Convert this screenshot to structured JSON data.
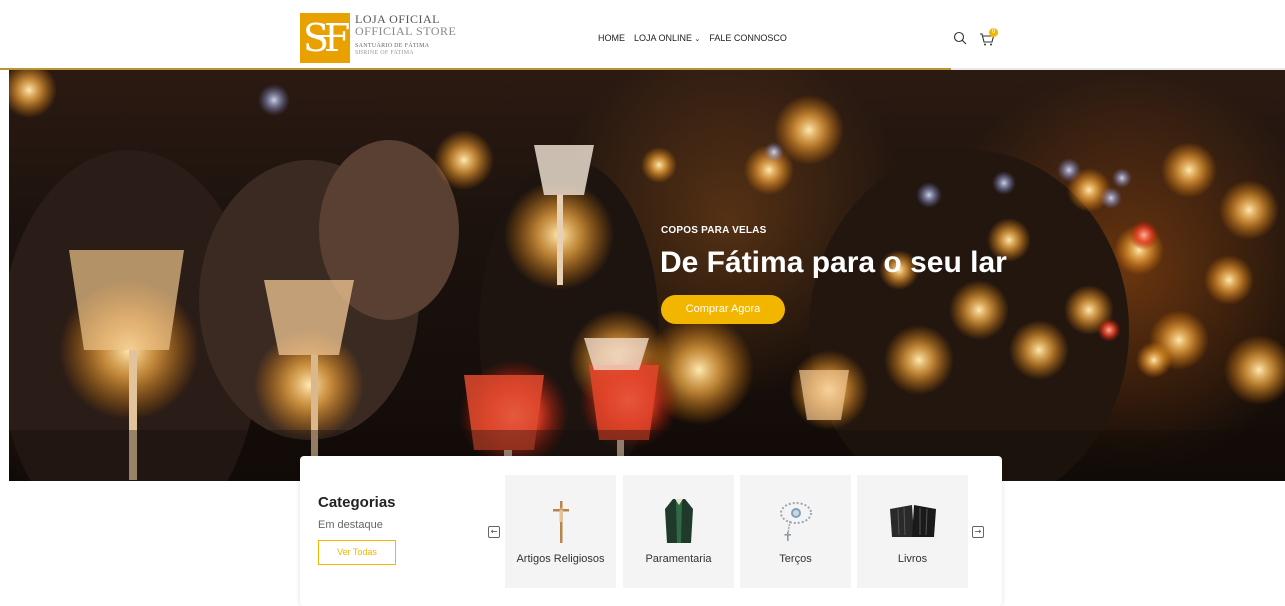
{
  "header": {
    "logo": {
      "line1": "LOJA OFICIAL",
      "line2": "OFFICIAL STORE",
      "line3": "SANTUÁRIO DE FÁTIMA",
      "line4": "SHRINE OF FATIMA",
      "monogram": "SF"
    },
    "nav": [
      {
        "label": "HOME"
      },
      {
        "label": "LOJA ONLINE",
        "has_dropdown": true
      },
      {
        "label": "FALE CONNOSCO"
      }
    ],
    "icons": {
      "search": "search-icon",
      "cart": "cart-icon"
    },
    "cart_count": "0",
    "progress_fraction": 0.74
  },
  "hero": {
    "eyebrow": "COPOS PARA VELAS",
    "title": "De Fátima para o seu lar",
    "button_label": "Comprar Agora"
  },
  "categories": {
    "title": "Categorias",
    "subtitle": "Em destaque",
    "button_label": "Ver Todas",
    "prev_icon": "arrow-left-icon",
    "next_icon": "arrow-right-icon",
    "items": [
      {
        "label": "Artigos Religiosos",
        "icon": "crucifix-icon"
      },
      {
        "label": "Paramentaria",
        "icon": "vestment-icon"
      },
      {
        "label": "Terços",
        "icon": "rosary-icon"
      },
      {
        "label": "Livros",
        "icon": "books-icon"
      }
    ]
  },
  "colors": {
    "accent": "#f2b500",
    "logo": "#e9a100",
    "progress": "#b99538"
  }
}
